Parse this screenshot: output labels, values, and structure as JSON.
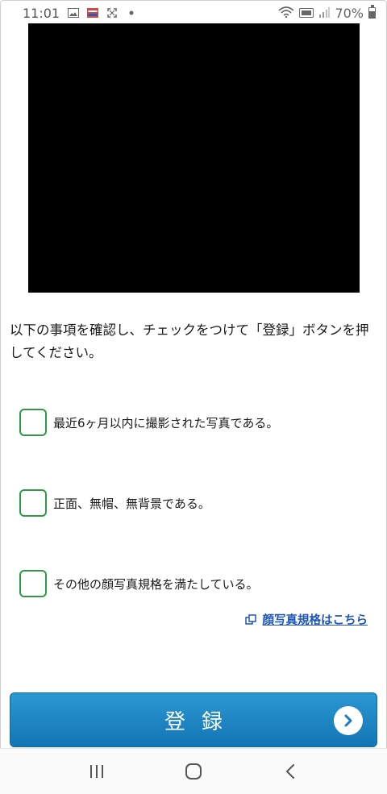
{
  "status_bar": {
    "time": "11:01",
    "battery": "70%",
    "battery_level": 0.7
  },
  "instruction": "以下の事項を確認し、チェックをつけて「登録」ボタンを押してください。",
  "checks": [
    {
      "label": "最近6ヶ月以内に撮影された写真である。",
      "checked": false
    },
    {
      "label": "正面、無帽、無背景である。",
      "checked": false
    },
    {
      "label": "その他の顔写真規格を満たしている。",
      "checked": false
    }
  ],
  "spec_link": "顔写真規格はこちら",
  "register_button": "登録",
  "colors": {
    "checkbox_border": "#2e9a48",
    "link": "#1f56b8",
    "button_top": "#2b97d3",
    "button_bottom": "#1375b4"
  },
  "icons": {
    "back": "chevron-left-icon",
    "home": "home-icon",
    "recents": "recents-icon",
    "arrow": "chevron-right-circle-icon"
  }
}
